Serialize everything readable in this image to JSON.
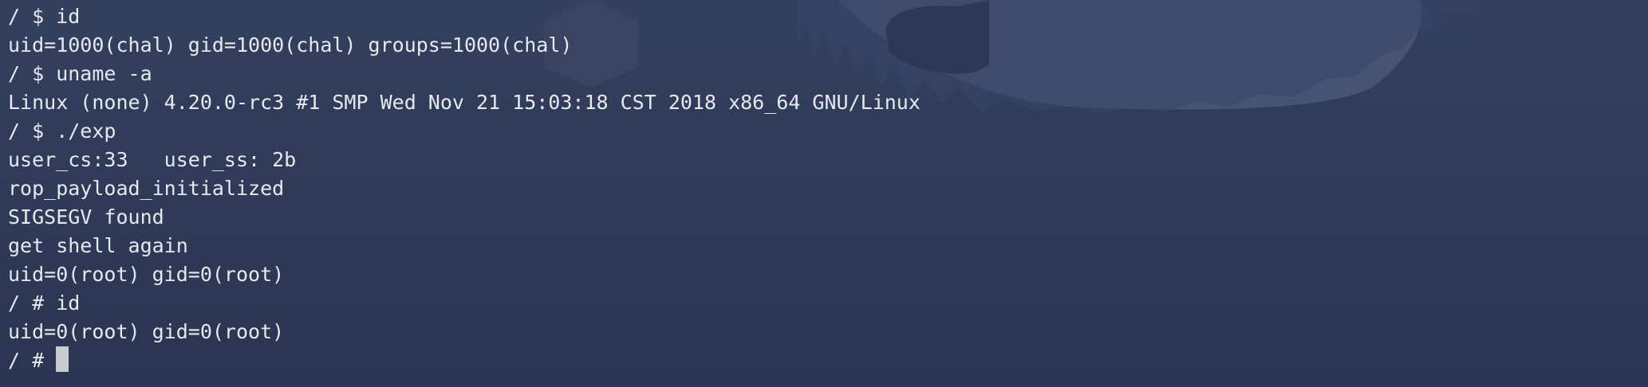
{
  "terminal": {
    "lines": [
      "/ $ id",
      "uid=1000(chal) gid=1000(chal) groups=1000(chal)",
      "/ $ uname -a",
      "Linux (none) 4.20.0-rc3 #1 SMP Wed Nov 21 15:03:18 CST 2018 x86_64 GNU/Linux",
      "/ $ ./exp",
      "user_cs:33   user_ss: 2b",
      "rop_payload_initialized",
      "SIGSEGV found",
      "get shell again",
      "uid=0(root) gid=0(root)",
      "/ # id",
      "uid=0(root) gid=0(root)"
    ],
    "prompt": "/ # "
  },
  "colors": {
    "background": "#2d3a55",
    "text": "#e6e8ee",
    "cursor": "#c9cbd0"
  }
}
